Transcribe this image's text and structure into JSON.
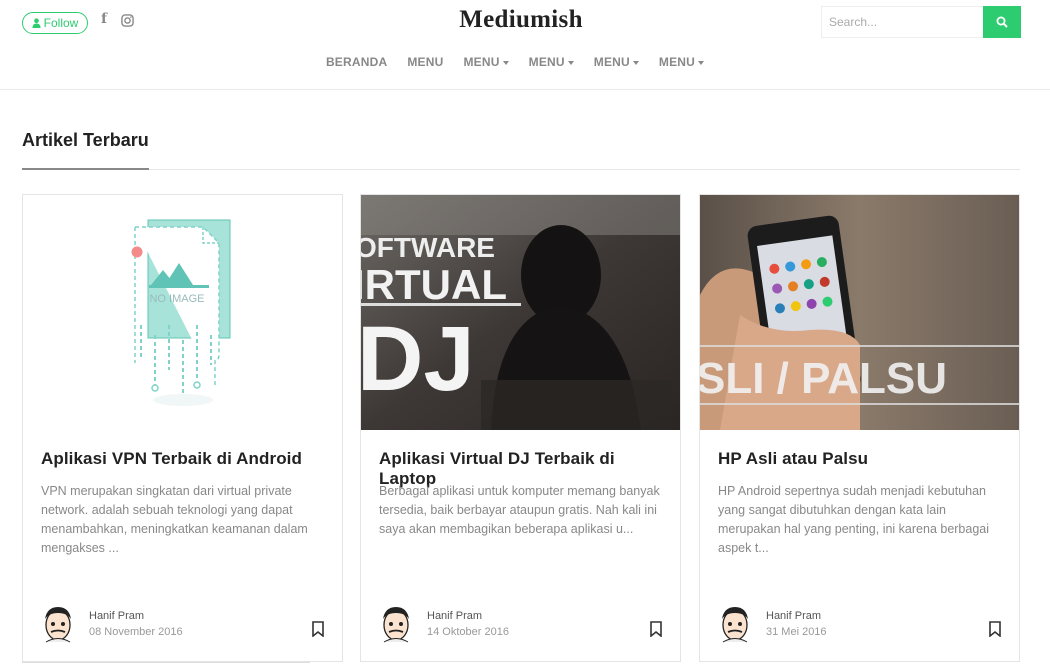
{
  "header": {
    "follow_label": "Follow",
    "brand": "Mediumish",
    "search_placeholder": "Search...",
    "social": [
      "facebook-icon",
      "instagram-icon"
    ]
  },
  "nav": [
    {
      "label": "BERANDA",
      "dropdown": false
    },
    {
      "label": "MENU",
      "dropdown": false
    },
    {
      "label": "MENU",
      "dropdown": true
    },
    {
      "label": "MENU",
      "dropdown": true
    },
    {
      "label": "MENU",
      "dropdown": true
    },
    {
      "label": "MENU",
      "dropdown": true
    }
  ],
  "section": {
    "title": "Artikel Terbaru"
  },
  "posts": [
    {
      "title": "Aplikasi VPN Terbaik di Android",
      "excerpt": "VPN merupakan singkatan dari virtual private network. adalah sebuah teknologi yang dapat menambahkan, meningkatkan keamanan dalam mengakses ...",
      "author": "Hanif Pram",
      "date": "08 November 2016",
      "thumb_text": "NO IMAGE"
    },
    {
      "title": "Aplikasi Virtual DJ Terbaik di Laptop",
      "excerpt": "Berbagai aplikasi untuk komputer memang banyak tersedia, baik berbayar ataupun gratis. Nah kali ini saya akan membagikan beberapa aplikasi u...",
      "author": "Hanif Pram",
      "date": "14 Oktober 2016",
      "thumb_lines": [
        "OFTWARE",
        "IRTUAL",
        "DJ"
      ]
    },
    {
      "title": "HP Asli atau Palsu",
      "excerpt": "HP Android sepertnya sudah menjadi kebutuhan yang sangat dibutuhkan dengan kata lain merupakan hal yang penting, ini karena berbagai aspek t...",
      "author": "Hanif Pram",
      "date": "31 Mei 2016",
      "thumb_text": "SLI / PALSU"
    }
  ],
  "colors": {
    "accent": "#2ecc71",
    "thumb_teal": "#7fd3c8"
  }
}
